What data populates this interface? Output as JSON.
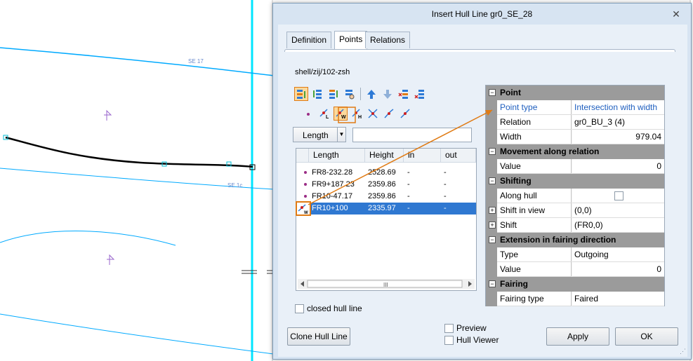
{
  "canvas": {
    "curve_labels": [
      "SE 17",
      "SE 1c"
    ],
    "markers": [
      "station-marker-icon",
      "station-marker-icon"
    ],
    "colors": {
      "hull_line": "#000000",
      "grid_line": "#00aaff",
      "accent_line": "#00e5ff",
      "marker": "#9966cc",
      "callout": "#e07b14"
    }
  },
  "dialog": {
    "title": "Insert Hull Line gr0_SE_28",
    "tabs": [
      {
        "label": "Definition"
      },
      {
        "label": "Points"
      },
      {
        "label": "Relations"
      }
    ],
    "active_tab": "Points",
    "path": "shell/zij/102-zsh",
    "toolbar_row1_icons": [
      "insert-point-icon",
      "insert-before-icon",
      "insert-after-icon",
      "pick-point-icon",
      "move-up-icon",
      "move-down-icon",
      "delete-point-icon",
      "delete-all-icon"
    ],
    "toolbar_row2_icons": [
      "point-icon",
      "point-length-icon",
      "point-width-icon",
      "point-height-icon",
      "intersection-icon",
      "tangent-icon",
      "knuckle-icon"
    ],
    "length_dropdown": {
      "label": "Length",
      "value": ""
    },
    "table": {
      "headers": [
        "Length",
        "Height",
        "in",
        "out"
      ],
      "rows": [
        {
          "length": "FR8-232.28",
          "height": "2528.69",
          "in": "-",
          "out": "-"
        },
        {
          "length": "FR9+187.23",
          "height": "2359.86",
          "in": "-",
          "out": "-"
        },
        {
          "length": "FR10-47.17",
          "height": "2359.86",
          "in": "-",
          "out": "-"
        },
        {
          "length": "FR10+100",
          "height": "2335.97",
          "in": "-",
          "out": "-"
        }
      ],
      "selected_row": 3,
      "scroll_thumb": "III"
    },
    "closed_hull_line": {
      "label": "closed hull line",
      "checked": false
    },
    "clone_button": "Clone Hull Line",
    "preview": {
      "label": "Preview",
      "checked": false
    },
    "hull_viewer": {
      "label": "Hull Viewer",
      "checked": false
    },
    "apply_button": "Apply",
    "ok_button": "OK",
    "properties": {
      "point": {
        "label": "Point",
        "rows": [
          {
            "key": "Point type",
            "value": "Intersection with width"
          },
          {
            "key": "Relation",
            "value": "gr0_BU_3 (4)"
          },
          {
            "key": "Width",
            "value": "979.04"
          }
        ]
      },
      "movement": {
        "label": "Movement along relation",
        "rows": [
          {
            "key": "Value",
            "value": "0"
          }
        ]
      },
      "shifting": {
        "label": "Shifting",
        "rows": [
          {
            "key": "Along hull",
            "value": ""
          },
          {
            "key": "Shift in view",
            "value": "(0,0)"
          },
          {
            "key": "Shift",
            "value": "(FR0,0)"
          }
        ]
      },
      "extension": {
        "label": "Extension in fairing direction",
        "rows": [
          {
            "key": "Type",
            "value": "Outgoing"
          },
          {
            "key": "Value",
            "value": "0"
          }
        ]
      },
      "fairing": {
        "label": "Fairing",
        "rows": [
          {
            "key": "Fairing type",
            "value": "Faired"
          }
        ]
      }
    }
  }
}
